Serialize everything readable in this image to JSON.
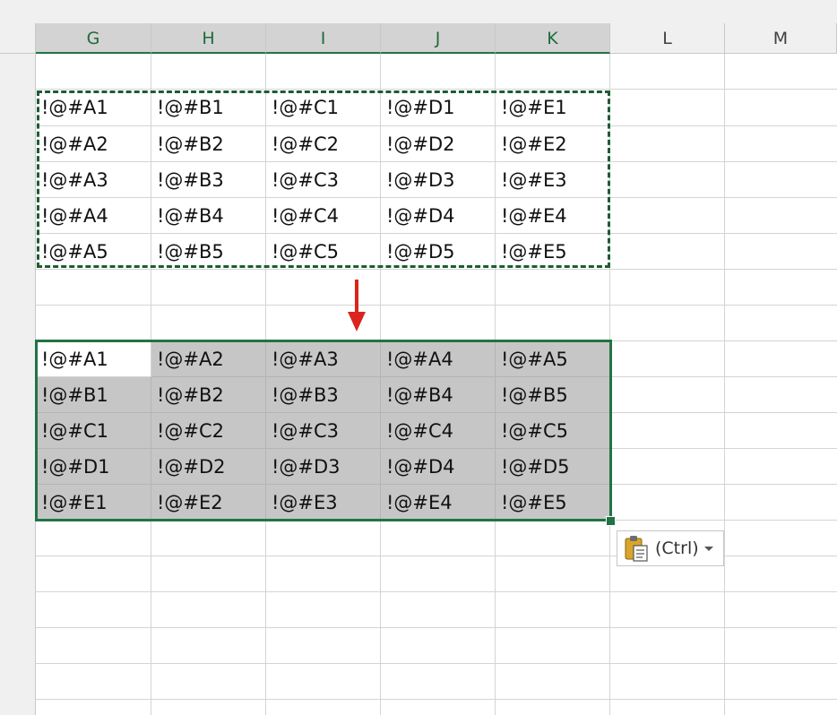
{
  "columns": [
    "G",
    "H",
    "I",
    "J",
    "K",
    "L",
    "M"
  ],
  "source_range": [
    [
      "!@#A1",
      "!@#B1",
      "!@#C1",
      "!@#D1",
      "!@#E1"
    ],
    [
      "!@#A2",
      "!@#B2",
      "!@#C2",
      "!@#D2",
      "!@#E2"
    ],
    [
      "!@#A3",
      "!@#B3",
      "!@#C3",
      "!@#D3",
      "!@#E3"
    ],
    [
      "!@#A4",
      "!@#B4",
      "!@#C4",
      "!@#D4",
      "!@#E4"
    ],
    [
      "!@#A5",
      "!@#B5",
      "!@#C5",
      "!@#D5",
      "!@#E5"
    ]
  ],
  "pasted_range": [
    [
      "!@#A1",
      "!@#A2",
      "!@#A3",
      "!@#A4",
      "!@#A5"
    ],
    [
      "!@#B1",
      "!@#B2",
      "!@#B3",
      "!@#B4",
      "!@#B5"
    ],
    [
      "!@#C1",
      "!@#C2",
      "!@#C3",
      "!@#C4",
      "!@#C5"
    ],
    [
      "!@#D1",
      "!@#D2",
      "!@#D3",
      "!@#D4",
      "!@#D5"
    ],
    [
      "!@#E1",
      "!@#E2",
      "!@#E3",
      "!@#E4",
      "!@#E5"
    ]
  ],
  "paste_options": {
    "label": "(Ctrl)",
    "icon": "clipboard-paste-icon"
  },
  "colors": {
    "selection_border": "#217346",
    "selected_fill": "#c6c6c6",
    "marching_ants": "#1e5c33",
    "arrow": "#d9251d",
    "selected_header_fill": "#d3d3d3",
    "header_fill": "#f0f0f0",
    "gridline": "#d4d4d4"
  }
}
